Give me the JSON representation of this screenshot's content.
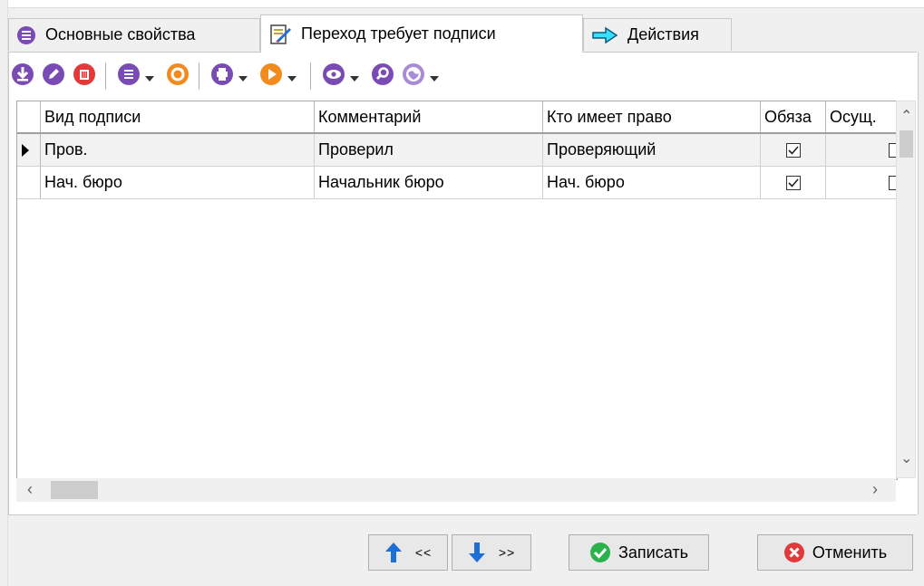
{
  "tabs": [
    {
      "label": "Основные свойства",
      "icon": "list-icon",
      "active": false
    },
    {
      "label": "Переход требует подписи",
      "icon": "sign-document-icon",
      "active": true
    },
    {
      "label": "Действия",
      "icon": "arrow-right-icon",
      "active": false
    }
  ],
  "toolbar": {
    "icons": [
      "download-icon",
      "edit-icon",
      "delete-icon",
      "list-icon",
      "refresh-icon",
      "print-icon",
      "play-icon",
      "view-icon",
      "search-icon",
      "globe-icon"
    ]
  },
  "grid": {
    "columns": [
      "Вид подписи",
      "Комментарий",
      "Кто имеет право",
      "Обяза",
      "Осущ."
    ],
    "rows": [
      {
        "vid": "Пров.",
        "comment": "Проверил",
        "who": "Проверяющий",
        "required": true,
        "done": false
      },
      {
        "vid": "Нач. бюро",
        "comment": "Начальник бюро",
        "who": "Нач. бюро",
        "required": true,
        "done": false
      }
    ]
  },
  "footer": {
    "prev_label": "<<",
    "next_label": ">>",
    "save_label": "Записать",
    "cancel_label": "Отменить"
  },
  "colors": {
    "purple": "#7b4bb5",
    "orange": "#f28a1e",
    "red": "#e03a3a",
    "blue": "#1c6fd6",
    "green": "#2bb24c"
  }
}
